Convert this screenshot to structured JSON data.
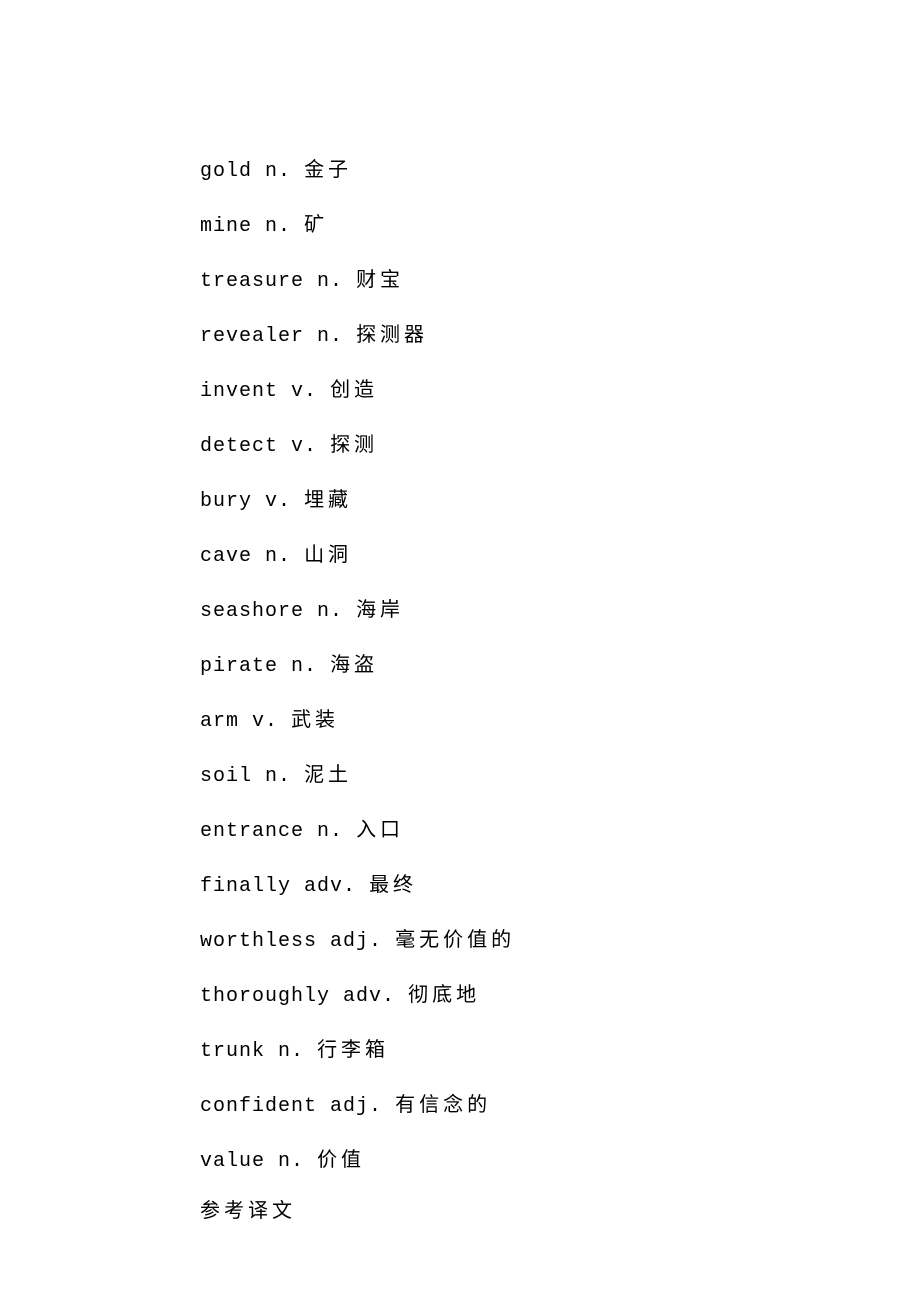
{
  "entries": [
    {
      "word": "gold",
      "pos": "n.",
      "def": "金子"
    },
    {
      "word": "mine",
      "pos": "n.",
      "def": "矿"
    },
    {
      "word": "treasure",
      "pos": "n.",
      "def": "财宝"
    },
    {
      "word": "revealer",
      "pos": "n.",
      "def": "探测器"
    },
    {
      "word": "invent",
      "pos": "v.",
      "def": "创造"
    },
    {
      "word": "detect",
      "pos": "v.",
      "def": "探测"
    },
    {
      "word": "bury",
      "pos": "v.",
      "def": "埋藏"
    },
    {
      "word": "cave",
      "pos": "n.",
      "def": "山洞"
    },
    {
      "word": "seashore",
      "pos": "n.",
      "def": "海岸"
    },
    {
      "word": "pirate",
      "pos": "n.",
      "def": "海盗"
    },
    {
      "word": "arm",
      "pos": "v.",
      "def": "武装"
    },
    {
      "word": "soil",
      "pos": "n.",
      "def": "泥土"
    },
    {
      "word": "entrance",
      "pos": "n.",
      "def": "入口"
    },
    {
      "word": "finally",
      "pos": "adv.",
      "def": "最终"
    },
    {
      "word": "worthless",
      "pos": "adj.",
      "def": "毫无价值的"
    },
    {
      "word": "thoroughly",
      "pos": "adv.",
      "def": "彻底地"
    },
    {
      "word": "trunk",
      "pos": "n.",
      "def": "行李箱"
    },
    {
      "word": "confident",
      "pos": "adj.",
      "def": "有信念的"
    },
    {
      "word": "value",
      "pos": "n.",
      "def": "价值"
    }
  ],
  "footer": "参考译文"
}
